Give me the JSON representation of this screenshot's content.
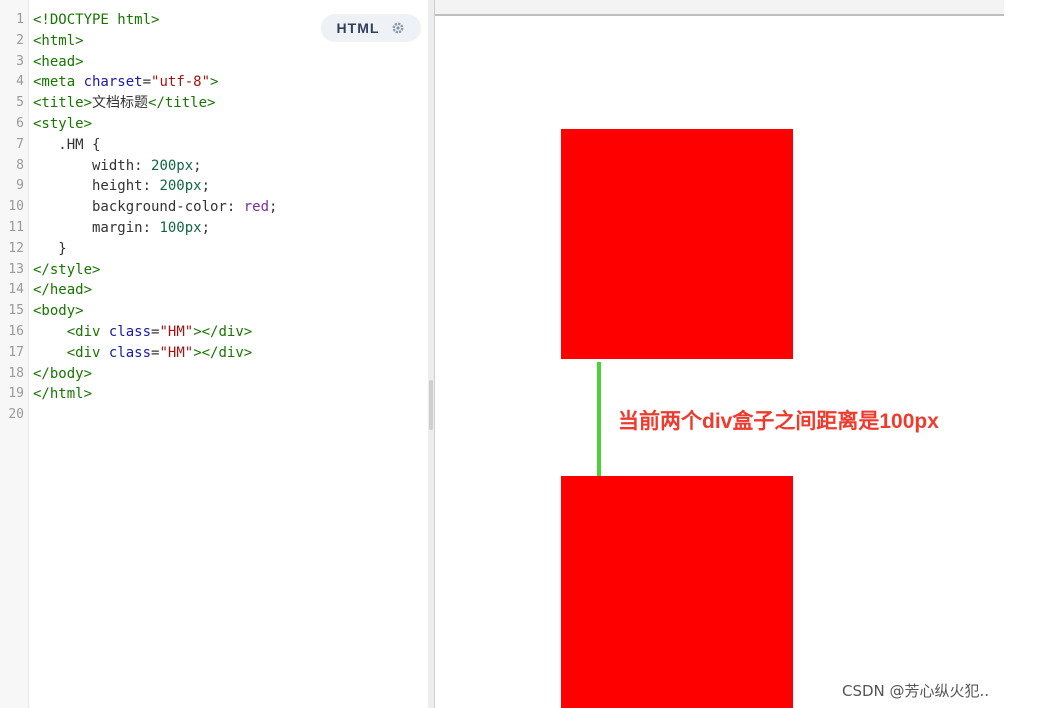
{
  "editor": {
    "language_label": "HTML",
    "lines": [
      {
        "n": "1",
        "parts": [
          [
            "tag",
            "<!DOCTYPE html>"
          ]
        ]
      },
      {
        "n": "2",
        "parts": [
          [
            "tag",
            "<html>"
          ]
        ]
      },
      {
        "n": "3",
        "parts": [
          [
            "tag",
            "<head>"
          ]
        ]
      },
      {
        "n": "4",
        "parts": [
          [
            "tag",
            "<meta "
          ],
          [
            "attr",
            "charset"
          ],
          [
            "plain",
            "="
          ],
          [
            "str",
            "\"utf-8\""
          ],
          [
            "tag",
            ">"
          ]
        ]
      },
      {
        "n": "5",
        "parts": [
          [
            "tag",
            "<title>"
          ],
          [
            "plain",
            "文档标题"
          ],
          [
            "tag",
            "</title>"
          ]
        ]
      },
      {
        "n": "6",
        "parts": [
          [
            "tag",
            "<style>"
          ]
        ]
      },
      {
        "n": "7",
        "parts": [
          [
            "plain",
            "   .HM {"
          ]
        ]
      },
      {
        "n": "8",
        "parts": [
          [
            "plain",
            "       width: "
          ],
          [
            "num",
            "200px"
          ],
          [
            "plain",
            ";"
          ]
        ]
      },
      {
        "n": "9",
        "parts": [
          [
            "plain",
            "       height: "
          ],
          [
            "num",
            "200px"
          ],
          [
            "plain",
            ";"
          ]
        ]
      },
      {
        "n": "10",
        "parts": [
          [
            "plain",
            "       background-color: "
          ],
          [
            "kw",
            "red"
          ],
          [
            "plain",
            ";"
          ]
        ]
      },
      {
        "n": "11",
        "parts": [
          [
            "plain",
            "       margin: "
          ],
          [
            "num",
            "100px"
          ],
          [
            "plain",
            ";"
          ]
        ]
      },
      {
        "n": "12",
        "parts": [
          [
            "plain",
            "   }"
          ]
        ]
      },
      {
        "n": "13",
        "parts": [
          [
            "tag",
            "</style>"
          ]
        ]
      },
      {
        "n": "14",
        "parts": [
          [
            "tag",
            "</head>"
          ]
        ]
      },
      {
        "n": "15",
        "parts": [
          [
            "tag",
            "<body>"
          ]
        ]
      },
      {
        "n": "16",
        "parts": [
          [
            "plain",
            "    "
          ],
          [
            "tag",
            "<div "
          ],
          [
            "attr",
            "class"
          ],
          [
            "plain",
            "="
          ],
          [
            "str",
            "\"HM\""
          ],
          [
            "tag",
            "></div>"
          ]
        ]
      },
      {
        "n": "17",
        "parts": [
          [
            "plain",
            "    "
          ],
          [
            "tag",
            "<div "
          ],
          [
            "attr",
            "class"
          ],
          [
            "plain",
            "="
          ],
          [
            "str",
            "\"HM\""
          ],
          [
            "tag",
            "></div>"
          ]
        ]
      },
      {
        "n": "18",
        "parts": [
          [
            "tag",
            "</body>"
          ]
        ]
      },
      {
        "n": "19",
        "parts": [
          [
            "tag",
            "</html>"
          ]
        ]
      },
      {
        "n": "20",
        "parts": []
      }
    ]
  },
  "preview": {
    "box_color": "#ff0000",
    "gap_line_color": "#4cd137",
    "annotation": "当前两个div盒子之间距离是100px",
    "annotation_color": "#ee3b2d"
  },
  "watermark": "CSDN @芳心纵火犯.."
}
